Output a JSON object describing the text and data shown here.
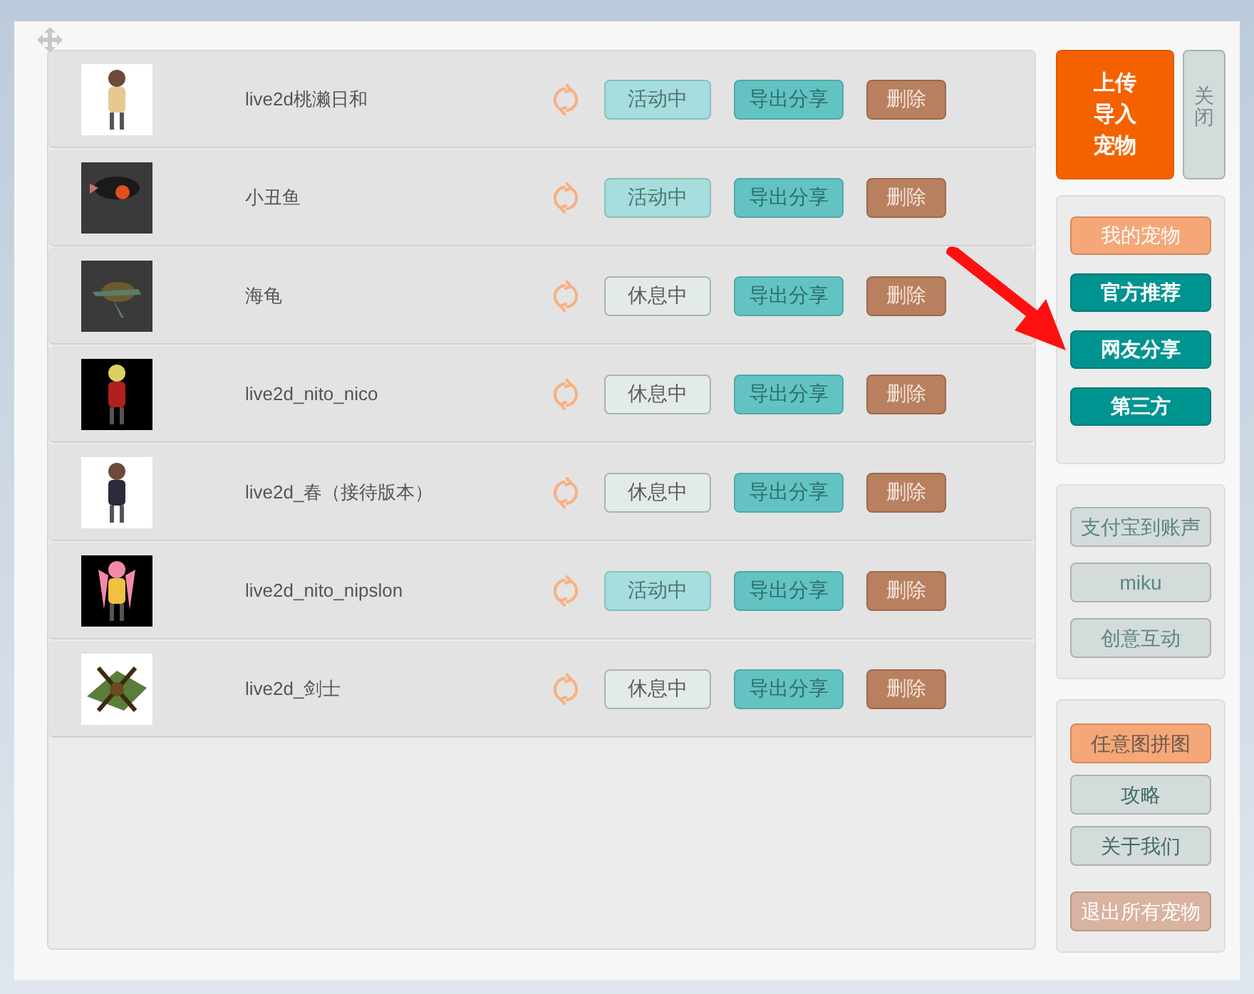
{
  "pets": [
    {
      "name": "live2d桃濑日和",
      "active": true,
      "status": "活动中",
      "export": "导出分享",
      "delete": "删除"
    },
    {
      "name": "小丑鱼",
      "active": true,
      "status": "活动中",
      "export": "导出分享",
      "delete": "删除"
    },
    {
      "name": "海龟",
      "active": false,
      "status": "休息中",
      "export": "导出分享",
      "delete": "删除"
    },
    {
      "name": "live2d_nito_nico",
      "active": false,
      "status": "休息中",
      "export": "导出分享",
      "delete": "删除"
    },
    {
      "name": "live2d_春（接待版本）",
      "active": false,
      "status": "休息中",
      "export": "导出分享",
      "delete": "删除"
    },
    {
      "name": "live2d_nito_nipslon",
      "active": true,
      "status": "活动中",
      "export": "导出分享",
      "delete": "删除"
    },
    {
      "name": "live2d_剑士",
      "active": false,
      "status": "休息中",
      "export": "导出分享",
      "delete": "删除"
    }
  ],
  "upload_button": "上传导入宠物",
  "close_button": "关闭",
  "categories": [
    {
      "label": "我的宠物",
      "selected": true
    },
    {
      "label": "官方推荐",
      "selected": false
    },
    {
      "label": "网友分享",
      "selected": false
    },
    {
      "label": "第三方",
      "selected": false
    }
  ],
  "links": [
    {
      "label": "支付宝到账声"
    },
    {
      "label": "miku"
    },
    {
      "label": "创意互动"
    }
  ],
  "tools": [
    {
      "label": "任意图拼图",
      "kind": "accent"
    },
    {
      "label": "攻略",
      "kind": "plain"
    },
    {
      "label": "关于我们",
      "kind": "plain"
    },
    {
      "label": "退出所有宠物",
      "kind": "danger"
    }
  ]
}
